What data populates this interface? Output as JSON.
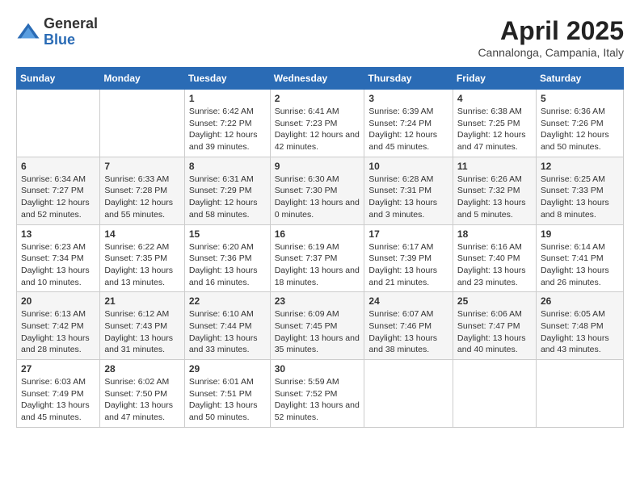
{
  "header": {
    "logo_general": "General",
    "logo_blue": "Blue",
    "month_title": "April 2025",
    "location": "Cannalonga, Campania, Italy"
  },
  "columns": [
    "Sunday",
    "Monday",
    "Tuesday",
    "Wednesday",
    "Thursday",
    "Friday",
    "Saturday"
  ],
  "weeks": [
    [
      {
        "day": "",
        "sunrise": "",
        "sunset": "",
        "daylight": ""
      },
      {
        "day": "",
        "sunrise": "",
        "sunset": "",
        "daylight": ""
      },
      {
        "day": "1",
        "sunrise": "Sunrise: 6:42 AM",
        "sunset": "Sunset: 7:22 PM",
        "daylight": "Daylight: 12 hours and 39 minutes."
      },
      {
        "day": "2",
        "sunrise": "Sunrise: 6:41 AM",
        "sunset": "Sunset: 7:23 PM",
        "daylight": "Daylight: 12 hours and 42 minutes."
      },
      {
        "day": "3",
        "sunrise": "Sunrise: 6:39 AM",
        "sunset": "Sunset: 7:24 PM",
        "daylight": "Daylight: 12 hours and 45 minutes."
      },
      {
        "day": "4",
        "sunrise": "Sunrise: 6:38 AM",
        "sunset": "Sunset: 7:25 PM",
        "daylight": "Daylight: 12 hours and 47 minutes."
      },
      {
        "day": "5",
        "sunrise": "Sunrise: 6:36 AM",
        "sunset": "Sunset: 7:26 PM",
        "daylight": "Daylight: 12 hours and 50 minutes."
      }
    ],
    [
      {
        "day": "6",
        "sunrise": "Sunrise: 6:34 AM",
        "sunset": "Sunset: 7:27 PM",
        "daylight": "Daylight: 12 hours and 52 minutes."
      },
      {
        "day": "7",
        "sunrise": "Sunrise: 6:33 AM",
        "sunset": "Sunset: 7:28 PM",
        "daylight": "Daylight: 12 hours and 55 minutes."
      },
      {
        "day": "8",
        "sunrise": "Sunrise: 6:31 AM",
        "sunset": "Sunset: 7:29 PM",
        "daylight": "Daylight: 12 hours and 58 minutes."
      },
      {
        "day": "9",
        "sunrise": "Sunrise: 6:30 AM",
        "sunset": "Sunset: 7:30 PM",
        "daylight": "Daylight: 13 hours and 0 minutes."
      },
      {
        "day": "10",
        "sunrise": "Sunrise: 6:28 AM",
        "sunset": "Sunset: 7:31 PM",
        "daylight": "Daylight: 13 hours and 3 minutes."
      },
      {
        "day": "11",
        "sunrise": "Sunrise: 6:26 AM",
        "sunset": "Sunset: 7:32 PM",
        "daylight": "Daylight: 13 hours and 5 minutes."
      },
      {
        "day": "12",
        "sunrise": "Sunrise: 6:25 AM",
        "sunset": "Sunset: 7:33 PM",
        "daylight": "Daylight: 13 hours and 8 minutes."
      }
    ],
    [
      {
        "day": "13",
        "sunrise": "Sunrise: 6:23 AM",
        "sunset": "Sunset: 7:34 PM",
        "daylight": "Daylight: 13 hours and 10 minutes."
      },
      {
        "day": "14",
        "sunrise": "Sunrise: 6:22 AM",
        "sunset": "Sunset: 7:35 PM",
        "daylight": "Daylight: 13 hours and 13 minutes."
      },
      {
        "day": "15",
        "sunrise": "Sunrise: 6:20 AM",
        "sunset": "Sunset: 7:36 PM",
        "daylight": "Daylight: 13 hours and 16 minutes."
      },
      {
        "day": "16",
        "sunrise": "Sunrise: 6:19 AM",
        "sunset": "Sunset: 7:37 PM",
        "daylight": "Daylight: 13 hours and 18 minutes."
      },
      {
        "day": "17",
        "sunrise": "Sunrise: 6:17 AM",
        "sunset": "Sunset: 7:39 PM",
        "daylight": "Daylight: 13 hours and 21 minutes."
      },
      {
        "day": "18",
        "sunrise": "Sunrise: 6:16 AM",
        "sunset": "Sunset: 7:40 PM",
        "daylight": "Daylight: 13 hours and 23 minutes."
      },
      {
        "day": "19",
        "sunrise": "Sunrise: 6:14 AM",
        "sunset": "Sunset: 7:41 PM",
        "daylight": "Daylight: 13 hours and 26 minutes."
      }
    ],
    [
      {
        "day": "20",
        "sunrise": "Sunrise: 6:13 AM",
        "sunset": "Sunset: 7:42 PM",
        "daylight": "Daylight: 13 hours and 28 minutes."
      },
      {
        "day": "21",
        "sunrise": "Sunrise: 6:12 AM",
        "sunset": "Sunset: 7:43 PM",
        "daylight": "Daylight: 13 hours and 31 minutes."
      },
      {
        "day": "22",
        "sunrise": "Sunrise: 6:10 AM",
        "sunset": "Sunset: 7:44 PM",
        "daylight": "Daylight: 13 hours and 33 minutes."
      },
      {
        "day": "23",
        "sunrise": "Sunrise: 6:09 AM",
        "sunset": "Sunset: 7:45 PM",
        "daylight": "Daylight: 13 hours and 35 minutes."
      },
      {
        "day": "24",
        "sunrise": "Sunrise: 6:07 AM",
        "sunset": "Sunset: 7:46 PM",
        "daylight": "Daylight: 13 hours and 38 minutes."
      },
      {
        "day": "25",
        "sunrise": "Sunrise: 6:06 AM",
        "sunset": "Sunset: 7:47 PM",
        "daylight": "Daylight: 13 hours and 40 minutes."
      },
      {
        "day": "26",
        "sunrise": "Sunrise: 6:05 AM",
        "sunset": "Sunset: 7:48 PM",
        "daylight": "Daylight: 13 hours and 43 minutes."
      }
    ],
    [
      {
        "day": "27",
        "sunrise": "Sunrise: 6:03 AM",
        "sunset": "Sunset: 7:49 PM",
        "daylight": "Daylight: 13 hours and 45 minutes."
      },
      {
        "day": "28",
        "sunrise": "Sunrise: 6:02 AM",
        "sunset": "Sunset: 7:50 PM",
        "daylight": "Daylight: 13 hours and 47 minutes."
      },
      {
        "day": "29",
        "sunrise": "Sunrise: 6:01 AM",
        "sunset": "Sunset: 7:51 PM",
        "daylight": "Daylight: 13 hours and 50 minutes."
      },
      {
        "day": "30",
        "sunrise": "Sunrise: 5:59 AM",
        "sunset": "Sunset: 7:52 PM",
        "daylight": "Daylight: 13 hours and 52 minutes."
      },
      {
        "day": "",
        "sunrise": "",
        "sunset": "",
        "daylight": ""
      },
      {
        "day": "",
        "sunrise": "",
        "sunset": "",
        "daylight": ""
      },
      {
        "day": "",
        "sunrise": "",
        "sunset": "",
        "daylight": ""
      }
    ]
  ]
}
